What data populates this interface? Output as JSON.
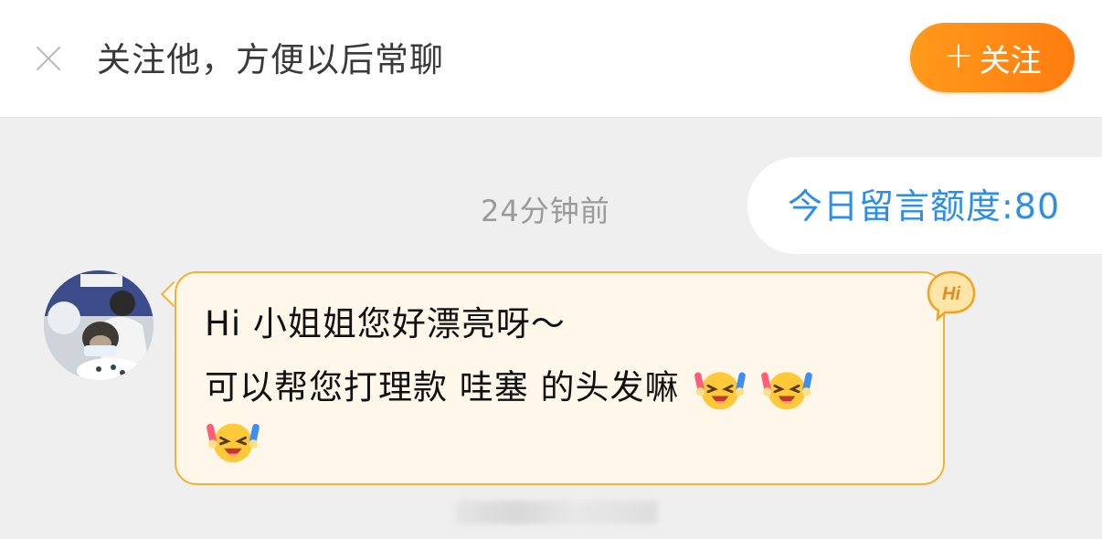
{
  "topbar": {
    "prompt_text": "关注他，方便以后常聊",
    "follow_button": {
      "plus": "+",
      "label": "关注"
    }
  },
  "chat": {
    "quota_text": "今日留言额度:80",
    "timestamp": "24分钟前",
    "message": {
      "line1": "Hi 小姐姐您好漂亮呀～",
      "line2": "可以帮您打理款 哇塞 的头发嘛"
    },
    "badge_text": "Hi"
  },
  "colors": {
    "accent_orange": "#ff8c14",
    "quota_blue": "#2d8ee6",
    "bubble_bg": "#fff8ea",
    "bubble_border": "#f2b23a"
  },
  "icons": [
    "close-icon",
    "laughing-emoji-icon",
    "hi-badge-icon",
    "avatar"
  ]
}
